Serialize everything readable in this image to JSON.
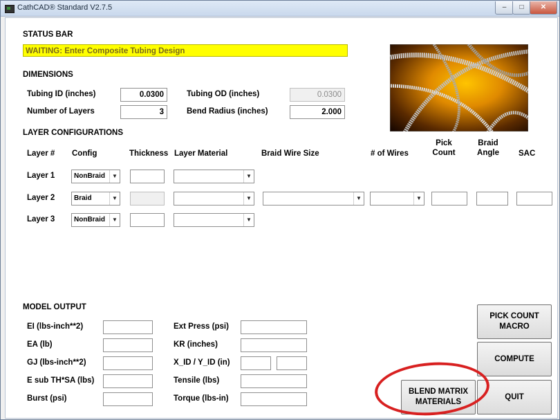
{
  "window": {
    "title": "CathCAD® Standard V2.7.5",
    "min_icon": "minimize-icon",
    "max_icon": "maximize-icon",
    "close_icon": "close-icon"
  },
  "status": {
    "heading": "STATUS BAR",
    "message": "WAITING: Enter Composite Tubing Design",
    "highlight_color": "#ffff00"
  },
  "dimensions": {
    "heading": "DIMENSIONS",
    "tubing_id_label": "Tubing ID (inches)",
    "tubing_id_value": "0.0300",
    "tubing_od_label": "Tubing OD (inches)",
    "tubing_od_value": "0.0300",
    "layers_label": "Number of Layers",
    "layers_value": "3",
    "bend_radius_label": "Bend Radius (inches)",
    "bend_radius_value": "2.000"
  },
  "layers": {
    "heading": "LAYER CONFIGURATIONS",
    "columns": {
      "layer": "Layer #",
      "config": "Config",
      "thickness": "Thickness",
      "material": "Layer Material",
      "wire_size": "Braid Wire Size",
      "wires": "# of Wires",
      "pick_count": "Pick Count",
      "braid_angle": "Braid Angle",
      "sac": "SAC"
    },
    "rows": [
      {
        "label": "Layer 1",
        "config": "NonBraid"
      },
      {
        "label": "Layer 2",
        "config": "Braid"
      },
      {
        "label": "Layer 3",
        "config": "NonBraid"
      }
    ]
  },
  "output": {
    "heading": "MODEL OUTPUT",
    "ei": "EI (lbs-inch**2)",
    "ea": "EA (lb)",
    "gj": "GJ (lbs-inch**2)",
    "esub": "E sub TH*SA (lbs)",
    "burst": "Burst (psi)",
    "ext_press": "Ext Press (psi)",
    "kr": "KR (inches)",
    "xid": "X_ID / Y_ID (in)",
    "tensile": "Tensile (lbs)",
    "torque": "Torque (lbs-in)"
  },
  "buttons": {
    "pick_count_macro": "PICK COUNT MACRO",
    "compute": "COMPUTE",
    "blend": "BLEND MATRIX MATERIALS",
    "quit": "QUIT"
  },
  "colors": {
    "annotation_circle": "#d82020"
  }
}
